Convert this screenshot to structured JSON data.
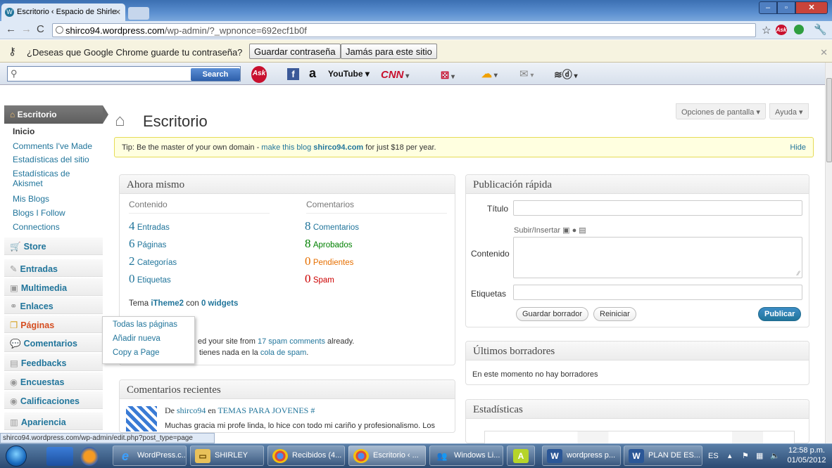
{
  "browser": {
    "tab_title": "Escritorio ‹ Espacio de Shirle",
    "url_host": "shirco94.wordpress.com",
    "url_path": "/wp-admin/?_wpnonce=692ecf1b0f",
    "password_prompt": "¿Deseas que Google Chrome guarde tu contraseña?",
    "save_password": "Guardar contraseña",
    "never_save": "Jamás para este sitio"
  },
  "toolbar": {
    "search_label": "Search",
    "icons": [
      "ask-icon",
      "facebook-icon",
      "amazon-icon",
      "youtube-icon",
      "cnn-icon",
      "dice-icon",
      "weather-icon",
      "mail-icon",
      "dictionary-icon"
    ],
    "ask": "Ask",
    "facebook": "f",
    "amazon": "a",
    "youtube": "YouTube",
    "cnn": "CNN"
  },
  "sidebar": {
    "header": "Escritorio",
    "subitems": [
      "Inicio",
      "Comments I've Made",
      "Estadísticas del sitio",
      "Estadísticas de Akismet",
      "Mis Blogs",
      "Blogs I Follow",
      "Connections"
    ],
    "items": [
      "Store",
      "Entradas",
      "Multimedia",
      "Enlaces",
      "Páginas",
      "Comentarios",
      "Feedbacks",
      "Encuestas",
      "Calificaciones",
      "Apariencia"
    ],
    "flyout": [
      "Todas las páginas",
      "Añadir nueva",
      "Copy a Page"
    ]
  },
  "header": {
    "title": "Escritorio",
    "screen_options": "Opciones de pantalla",
    "help": "Ayuda"
  },
  "tip": {
    "prefix": "Tip: Be the master of your own domain - ",
    "link1": "make this blog",
    "domain": "shirco94.com",
    "suffix": " for just $18 per year.",
    "hide": "Hide"
  },
  "right_now": {
    "title": "Ahora mismo",
    "content_label": "Contenido",
    "comments_label": "Comentarios",
    "content": [
      {
        "n": "4",
        "label": "Entradas"
      },
      {
        "n": "6",
        "label": "Páginas"
      },
      {
        "n": "2",
        "label": "Categorías"
      },
      {
        "n": "0",
        "label": "Etiquetas"
      }
    ],
    "comments": [
      {
        "n": "8",
        "label": "Comentarios",
        "color": "#21759b"
      },
      {
        "n": "8",
        "label": "Aprobados",
        "color": "#008000"
      },
      {
        "n": "0",
        "label": "Pendientes",
        "color": "#e66f00"
      },
      {
        "n": "0",
        "label": "Spam",
        "color": "#cc0000"
      }
    ],
    "theme_prefix": "Tema ",
    "theme": "iTheme2",
    "theme_mid": " con ",
    "widgets": "0 widgets",
    "akismet_a": "ed your site from ",
    "akismet_link": "17 spam comments",
    "akismet_b": " already.",
    "akismet_c": "tienes nada en la ",
    "akismet_link2": "cola de spam",
    "akismet_d": "."
  },
  "recent_comments": {
    "title": "Comentarios recientes",
    "by": "De ",
    "author": "shirco94",
    "on": " en ",
    "post": "TEMAS PARA JOVENES #",
    "text": "Muchas gracia mi profe linda, lo hice con todo mi cariño y profesionalismo. Los"
  },
  "quick_press": {
    "title": "Publicación rápida",
    "titulo": "Título",
    "upload": "Subir/Insertar",
    "contenido": "Contenido",
    "etiquetas": "Etiquetas",
    "save_draft": "Guardar borrador",
    "reset": "Reiniciar",
    "publish": "Publicar"
  },
  "drafts": {
    "title": "Últimos borradores",
    "empty": "En este momento no hay borradores"
  },
  "stats": {
    "title": "Estadísticas"
  },
  "statusbar": "shirco94.wordpress.com/wp-admin/edit.php?post_type=page",
  "taskbar": {
    "apps": [
      "WordPress.c...",
      "SHIRLEY",
      "Recibidos (4...",
      "Escritorio ‹ ...",
      "Windows Li...",
      "",
      "wordpress p...",
      "PLAN DE ES..."
    ],
    "lang": "ES",
    "time": "12:58 p.m.",
    "date": "01/05/2012"
  }
}
